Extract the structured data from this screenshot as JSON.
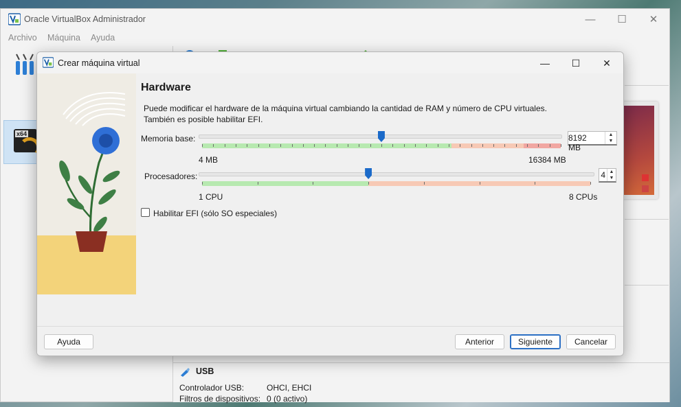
{
  "manager": {
    "title": "Oracle VirtualBox Administrador",
    "menu": [
      "Archivo",
      "Máquina",
      "Ayuda"
    ],
    "vm_badge": "x64",
    "usb": {
      "title": "USB",
      "rows": [
        {
          "label": "Controlador USB:",
          "value": "OHCI, EHCI"
        },
        {
          "label": "Filtros de dispositivos:",
          "value": "0 (0 activo)"
        }
      ]
    }
  },
  "dialog": {
    "title": "Crear máquina virtual",
    "heading": "Hardware",
    "description_line1": "Puede modificar el hardware de la máquina virtual cambiando la cantidad de RAM y número de CPU virtuales.",
    "description_line2": "También es posible habilitar EFI.",
    "memory": {
      "label": "Memoria base:",
      "value_text": "8192 MB",
      "value": 8192,
      "min": 4,
      "max": 16384,
      "min_label": "4 MB",
      "max_label": "16384 MB"
    },
    "cpu": {
      "label": "Procesadores:",
      "value_text": "4",
      "value": 4,
      "min": 1,
      "max": 8,
      "min_label": "1 CPU",
      "max_label": "8 CPUs"
    },
    "efi": {
      "label": "Habilitar EFI (sólo SO especiales)",
      "checked": false
    },
    "buttons": {
      "help": "Ayuda",
      "back": "Anterior",
      "next": "Siguiente",
      "cancel": "Cancelar"
    }
  },
  "colors": {
    "accent": "#1b6ac9",
    "scale_green": "#b7e9b0",
    "scale_orange": "#f7c9b5",
    "scale_red": "#f1a7a2",
    "floor": "#f3d37a",
    "flower": "#2f6fd6",
    "pot": "#8a2f22"
  }
}
